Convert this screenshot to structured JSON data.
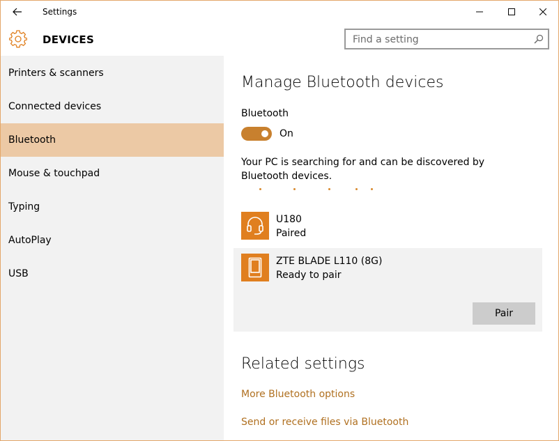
{
  "window": {
    "title": "Settings"
  },
  "header": {
    "section": "DEVICES",
    "search_placeholder": "Find a setting"
  },
  "sidebar": {
    "items": [
      {
        "label": "Printers & scanners"
      },
      {
        "label": "Connected devices"
      },
      {
        "label": "Bluetooth",
        "selected": true
      },
      {
        "label": "Mouse & touchpad"
      },
      {
        "label": "Typing"
      },
      {
        "label": "AutoPlay"
      },
      {
        "label": "USB"
      }
    ]
  },
  "main": {
    "title": "Manage Bluetooth devices",
    "bluetooth_label": "Bluetooth",
    "toggle_state": "On",
    "searching_text": "Your PC is searching for and can be discovered by Bluetooth devices.",
    "devices": [
      {
        "name": "U180",
        "status": "Paired",
        "icon": "headset-icon"
      },
      {
        "name": "ZTE BLADE L110 (8G)",
        "status": "Ready to pair",
        "icon": "phone-icon",
        "action": "Pair"
      }
    ],
    "related_title": "Related settings",
    "links": [
      {
        "label": "More Bluetooth options"
      },
      {
        "label": "Send or receive files via Bluetooth"
      }
    ]
  },
  "colors": {
    "accent": "#c8802e",
    "device_icon_bg": "#e07f1f",
    "selected_nav_bg": "#ecc9a5",
    "link": "#b07020"
  }
}
